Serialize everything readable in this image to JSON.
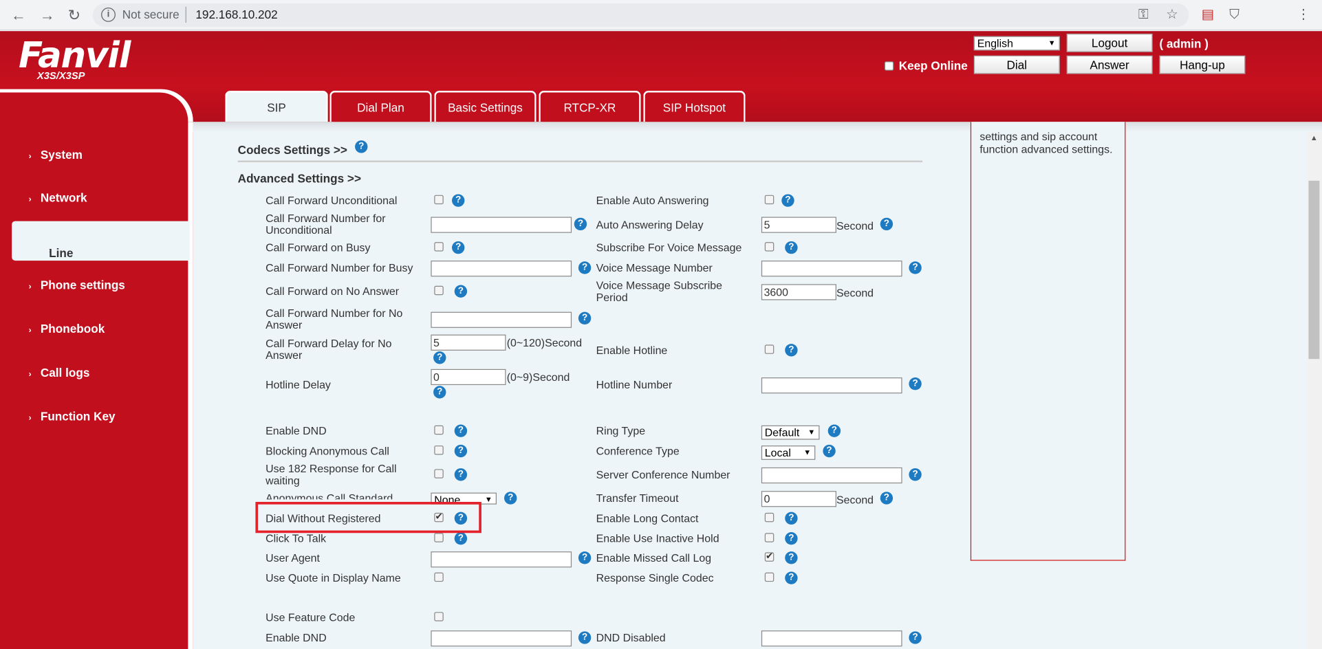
{
  "browser": {
    "security": "Not secure",
    "url": "192.168.10.202"
  },
  "header": {
    "logo": "Fanvil",
    "model": "X3S/X3SP",
    "language": "English",
    "logout": "Logout",
    "user": "( admin )",
    "keep_online": "Keep Online",
    "dial": "Dial",
    "answer": "Answer",
    "hangup": "Hang-up"
  },
  "tabs": [
    "SIP",
    "Dial Plan",
    "Basic Settings",
    "RTCP-XR",
    "SIP Hotspot"
  ],
  "sidebar": [
    "System",
    "Network",
    "Line",
    "Phone settings",
    "Phonebook",
    "Call logs",
    "Function Key"
  ],
  "sections": {
    "codecs": "Codecs Settings >>",
    "advanced": "Advanced Settings >>"
  },
  "help_text": "settings and sip account function advanced settings.",
  "left_fields": {
    "cfu": "Call Forward Unconditional",
    "cfnu": "Call Forward Number for Unconditional",
    "cfb": "Call Forward on Busy",
    "cfnb": "Call Forward Number for Busy",
    "cfna": "Call Forward on No Answer",
    "cfnna": "Call Forward Number for No Answer",
    "cfdna": "Call Forward Delay for No Answer",
    "cfdna_value": "5",
    "cfdna_unit": "(0~120)Second",
    "hotline_delay": "Hotline Delay",
    "hotline_delay_value": "0",
    "hotline_delay_unit": "(0~9)Second",
    "dnd": "Enable DND",
    "blocking": "Blocking Anonymous Call",
    "use182": "Use 182 Response for Call waiting",
    "anon_std": "Anonymous Call Standard",
    "anon_std_value": "None",
    "dial_wo_reg": "Dial Without Registered",
    "click_to_talk": "Click To Talk",
    "user_agent": "User Agent",
    "quote": "Use Quote in Display Name",
    "feature_code": "Use Feature Code",
    "dnd2": "Enable DND"
  },
  "right_fields": {
    "auto_ans": "Enable Auto Answering",
    "auto_ans_delay": "Auto Answering Delay",
    "auto_ans_delay_value": "5",
    "second": "Second",
    "sub_vm": "Subscribe For Voice Message",
    "vm_number": "Voice Message Number",
    "vm_period": "Voice Message Subscribe Period",
    "vm_period_value": "3600",
    "hotline": "Enable Hotline",
    "hotline_number": "Hotline Number",
    "ring_type": "Ring Type",
    "ring_type_value": "Default",
    "conf_type": "Conference Type",
    "conf_type_value": "Local",
    "server_conf": "Server Conference Number",
    "transfer_timeout": "Transfer Timeout",
    "transfer_timeout_value": "0",
    "long_contact": "Enable Long Contact",
    "inactive_hold": "Enable Use Inactive Hold",
    "missed_log": "Enable Missed Call Log",
    "single_codec": "Response Single Codec",
    "dnd_disabled": "DND Disabled"
  },
  "icons": {
    "help": "?"
  },
  "colors": {
    "brand_red": "#c10f1e",
    "help_blue": "#1e7ac1",
    "highlight": "#e3222c"
  }
}
